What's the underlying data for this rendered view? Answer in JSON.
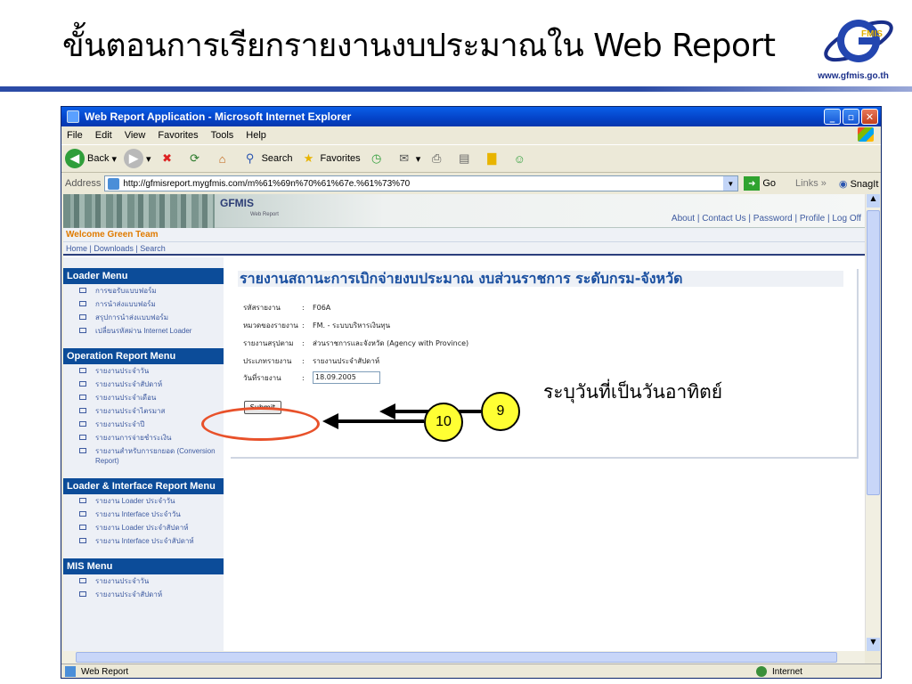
{
  "slide": {
    "title": "ขั้นตอนการเรียกรายงานงบประมาณใน Web Report",
    "logo_text": "FMIS",
    "logo_url": "www.gfmis.go.th"
  },
  "browser": {
    "window_title": "Web Report Application - Microsoft Internet Explorer",
    "menu": [
      "File",
      "Edit",
      "View",
      "Favorites",
      "Tools",
      "Help"
    ],
    "toolbar": {
      "back": "Back",
      "search": "Search",
      "favorites": "Favorites"
    },
    "address": {
      "label": "Address",
      "url": "http://gfmisreport.mygfmis.com/m%61%69n%70%61%67e.%61%73%70",
      "go": "Go",
      "links": "Links",
      "snagit": "SnagIt"
    },
    "status": {
      "left": "Web Report",
      "zone": "Internet"
    }
  },
  "site": {
    "brand": "GFMIS",
    "brand_sub": "Web Report",
    "top_links": "About | Contact Us | Password | Profile | Log Off",
    "welcome": "Welcome  Green Team",
    "nav": "Home | Downloads | Search"
  },
  "left_menu": [
    {
      "heading": "Loader Menu",
      "items": [
        "การขอรับแบบฟอร์ม",
        "การนำส่งแบบฟอร์ม",
        "สรุปการนำส่งแบบฟอร์ม",
        "เปลี่ยนรหัสผ่าน Internet Loader"
      ]
    },
    {
      "heading": "Operation Report Menu",
      "items": [
        "รายงานประจำวัน",
        "รายงานประจำสัปดาห์",
        "รายงานประจำเดือน",
        "รายงานประจำไตรมาส",
        "รายงานประจำปี",
        "รายงานการจ่ายชำระเงิน",
        "รายงานสำหรับการยกยอด (Conversion Report)"
      ]
    },
    {
      "heading": "Loader & Interface Report Menu",
      "items": [
        "รายงาน Loader ประจำวัน",
        "รายงาน Interface ประจำวัน",
        "รายงาน Loader ประจำสัปดาห์",
        "รายงาน Interface ประจำสัปดาห์"
      ]
    },
    {
      "heading": "MIS Menu",
      "items": [
        "รายงานประจำวัน",
        "รายงานประจำสัปดาห์"
      ]
    }
  ],
  "report": {
    "title": "รายงานสถานะการเบิกจ่ายงบประมาณ งบส่วนราชการ ระดับกรม-จังหวัด",
    "fields": [
      {
        "label": "รหัสรายงาน",
        "value": "F06A"
      },
      {
        "label": "หมวดของรายงาน",
        "value": "FM. - ระบบบริหารเงินทุน"
      },
      {
        "label": "รายงานสรุปตาม",
        "value": "ส่วนราชการและจังหวัด (Agency with Province)"
      },
      {
        "label": "ประเภทรายงาน",
        "value": "รายงานประจำสัปดาห์"
      }
    ],
    "date_label": "วันที่รายงาน",
    "date_value": "18.09.2005",
    "submit": "Submit"
  },
  "annotations": {
    "callout_9": "9",
    "callout_10": "10",
    "note_9": "ระบุวันที่เป็นวันอาทิตย์",
    "accent_color": "#e8512a",
    "callout_color": "#ffff33"
  }
}
